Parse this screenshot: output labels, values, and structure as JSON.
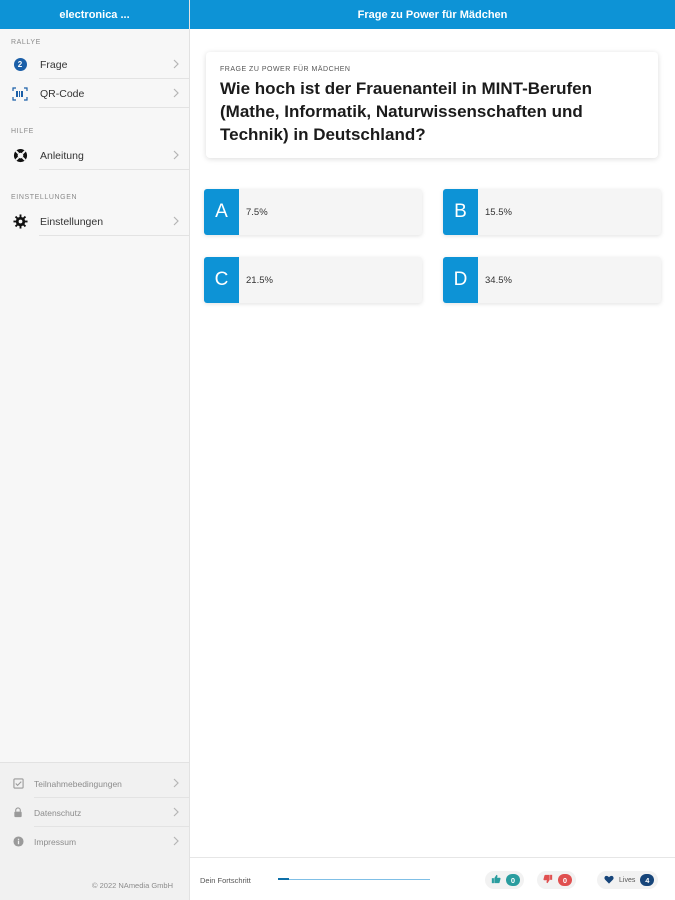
{
  "sidebar": {
    "title": "electronica ...",
    "sections": {
      "rallye": "RALLYE",
      "hilfe": "HILFE",
      "einstellungen": "EINSTELLUNGEN"
    },
    "items": {
      "frage": {
        "label": "Frage",
        "badge": "2"
      },
      "qr": {
        "label": "QR-Code"
      },
      "anleitung": {
        "label": "Anleitung"
      },
      "einstellungen": {
        "label": "Einstellungen"
      }
    },
    "bottom": {
      "teilnahme": "Teilnahmebedingungen",
      "datenschutz": "Datenschutz",
      "impressum": "Impressum",
      "copyright": "© 2022 NAmedia GmbH"
    }
  },
  "header": {
    "title": "Frage zu Power für Mädchen"
  },
  "question": {
    "kicker": "FRAGE ZU POWER FÜR MÄDCHEN",
    "text": "Wie hoch ist der Frauenanteil in MINT-Berufen (Mathe, Informatik, Naturwissenschaften und Technik) in Deutschland?"
  },
  "answers": [
    {
      "letter": "A",
      "value": "7.5%"
    },
    {
      "letter": "B",
      "value": "15.5%"
    },
    {
      "letter": "C",
      "value": "21.5%"
    },
    {
      "letter": "D",
      "value": "34.5%"
    }
  ],
  "footer": {
    "progress_label": "Dein Fortschritt",
    "progress_fraction": 0.07,
    "likes": "0",
    "dislikes": "0",
    "lives_label": "Lives",
    "lives": "4"
  },
  "colors": {
    "accent": "#0d93d6",
    "like": "#2a9d9f",
    "dislike": "#e05050",
    "lives": "#17457a"
  }
}
